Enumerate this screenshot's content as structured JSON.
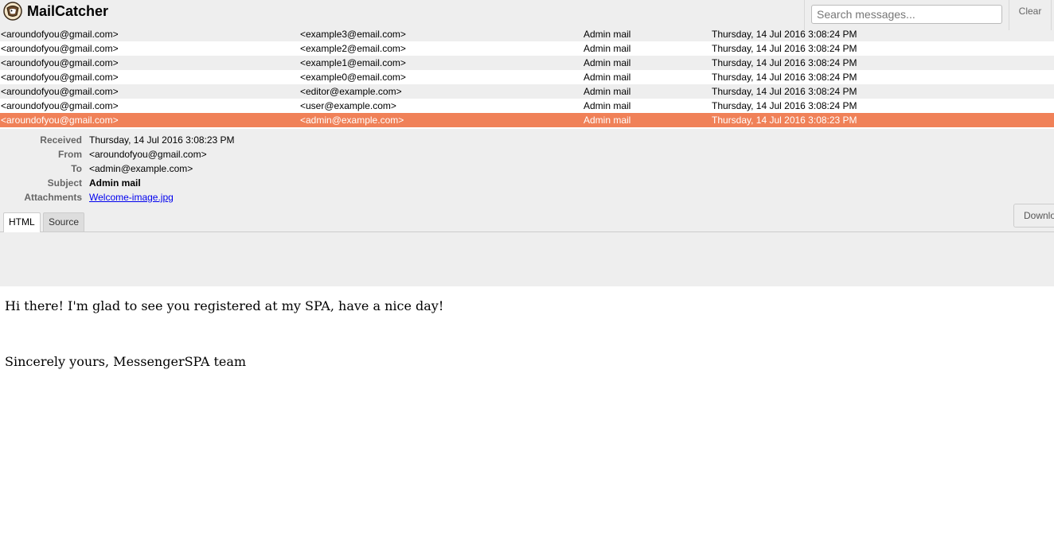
{
  "header": {
    "title": "MailCatcher",
    "logo_icon": "mailcatcher-logo-icon",
    "search_placeholder": "Search messages...",
    "clear_label": "Clear"
  },
  "messages": [
    {
      "from": "<aroundofyou@gmail.com>",
      "to": "<example3@email.com>",
      "subject": "Admin mail",
      "received": "Thursday, 14 Jul 2016 3:08:24 PM"
    },
    {
      "from": "<aroundofyou@gmail.com>",
      "to": "<example2@email.com>",
      "subject": "Admin mail",
      "received": "Thursday, 14 Jul 2016 3:08:24 PM"
    },
    {
      "from": "<aroundofyou@gmail.com>",
      "to": "<example1@email.com>",
      "subject": "Admin mail",
      "received": "Thursday, 14 Jul 2016 3:08:24 PM"
    },
    {
      "from": "<aroundofyou@gmail.com>",
      "to": "<example0@email.com>",
      "subject": "Admin mail",
      "received": "Thursday, 14 Jul 2016 3:08:24 PM"
    },
    {
      "from": "<aroundofyou@gmail.com>",
      "to": "<editor@example.com>",
      "subject": "Admin mail",
      "received": "Thursday, 14 Jul 2016 3:08:24 PM"
    },
    {
      "from": "<aroundofyou@gmail.com>",
      "to": "<user@example.com>",
      "subject": "Admin mail",
      "received": "Thursday, 14 Jul 2016 3:08:24 PM"
    },
    {
      "from": "<aroundofyou@gmail.com>",
      "to": "<admin@example.com>",
      "subject": "Admin mail",
      "received": "Thursday, 14 Jul 2016 3:08:23 PM",
      "selected": true
    }
  ],
  "selected_color": "#f08158",
  "detail": {
    "received_label": "Received",
    "received": "Thursday, 14 Jul 2016 3:08:23 PM",
    "from_label": "From",
    "from": "<aroundofyou@gmail.com>",
    "to_label": "To",
    "to": "<admin@example.com>",
    "subject_label": "Subject",
    "subject": "Admin mail",
    "attachments_label": "Attachments",
    "attachment": "Welcome-image.jpg"
  },
  "tabs": [
    {
      "label": "HTML",
      "active": true
    },
    {
      "label": "Source",
      "active": false
    }
  ],
  "download_label": "Download",
  "body": {
    "line1": "Hi there! I'm glad to see you registered at my SPA, have a nice day!",
    "line2": "Sincerely yours, MessengerSPA team"
  }
}
